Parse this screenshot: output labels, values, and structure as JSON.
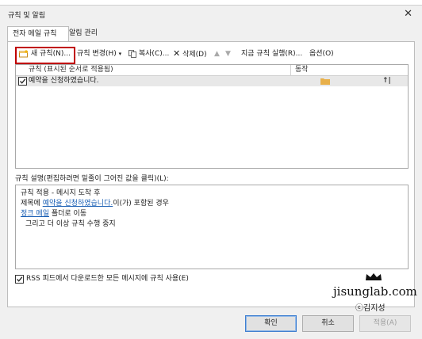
{
  "window": {
    "title": "규칙 및 알림"
  },
  "tabs": [
    {
      "label": "전자 메일 규칙"
    },
    {
      "label": "알림 관리"
    }
  ],
  "toolbar": {
    "new_rule": "새 규칙(N)...",
    "change_rule": "규칙 변경(H)",
    "copy": "복사(C)...",
    "delete": "삭제(D)",
    "run_now": "지금 규칙 실행(R)...",
    "options": "옵션(O)"
  },
  "rules_list": {
    "columns": [
      "규칙 (표시된 순서로 적용됨)",
      "동작"
    ],
    "rows": [
      {
        "name": "예약을 신청하였습니다.",
        "checked": true
      }
    ]
  },
  "description": {
    "label": "규칙 설명(편집하려면 밑줄이 그어진 값을 클릭)(L):",
    "line1": "규칙 적용 - 메시지 도착 후",
    "line2_pre": "제목에 ",
    "line2_link": "예약을 신청하였습니다.",
    "line2_post": "이(가) 포함된 경우",
    "line3_link": "정크 메일",
    "line3_post": " 폴더로 이동",
    "line4": "그리고 더 이상 규칙 수행 중지"
  },
  "rss": {
    "label": "RSS 피드에서 다운로드한 모든 메시지에 규칙 사용(E)",
    "checked": true
  },
  "watermark": {
    "site": "jisunglab.com",
    "author": "ⓒ김지성"
  },
  "buttons": {
    "ok": "확인",
    "cancel": "취소",
    "apply": "적용(A)"
  }
}
